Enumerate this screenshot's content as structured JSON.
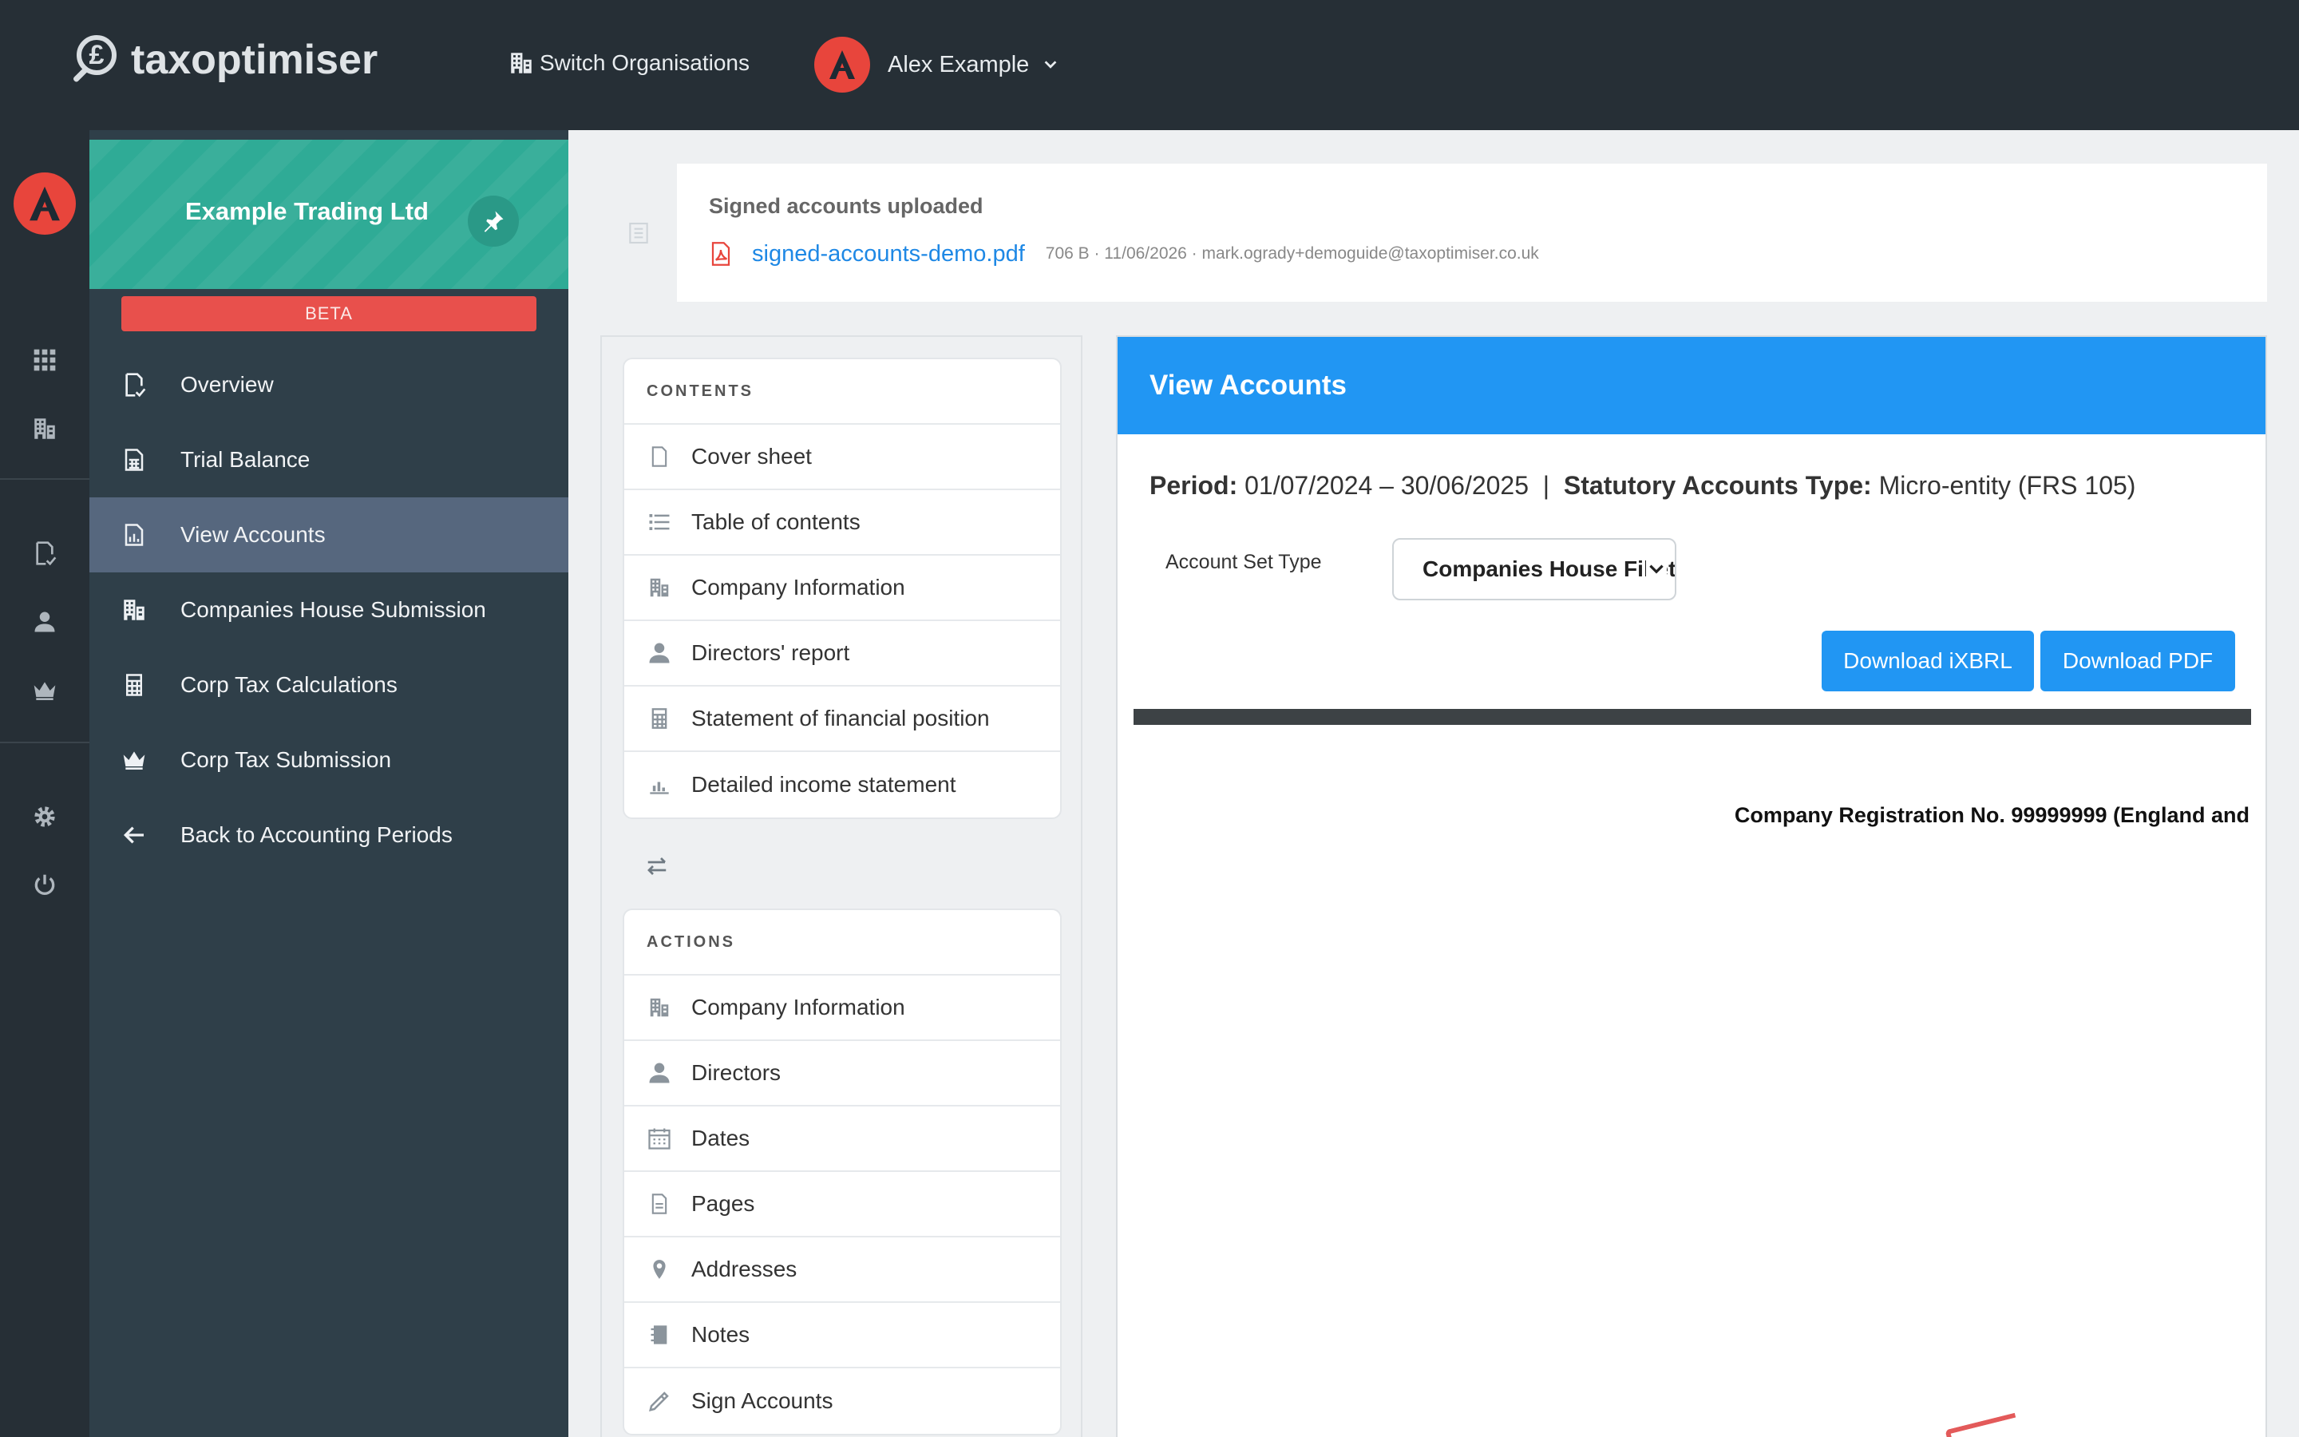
{
  "topbar": {
    "brand": "taxoptimiser",
    "switch_org": "Switch Organisations",
    "user_name": "Alex Example"
  },
  "rail": {
    "icons": [
      "avatar-icon",
      "apps-grid-icon",
      "organisation-icon",
      "document-check-icon",
      "person-icon",
      "crown-icon",
      "gear-icon",
      "power-icon"
    ]
  },
  "sidebar": {
    "org_name": "Example Trading Ltd",
    "beta_label": "BETA",
    "items": [
      {
        "label": "Overview",
        "icon": "document-check-icon"
      },
      {
        "label": "Trial Balance",
        "icon": "spreadsheet-icon"
      },
      {
        "label": "View Accounts",
        "icon": "report-chart-icon",
        "active": true
      },
      {
        "label": "Companies House Submission",
        "icon": "organisation-icon"
      },
      {
        "label": "Corp Tax Calculations",
        "icon": "calculator-icon"
      },
      {
        "label": "Corp Tax Submission",
        "icon": "crown-icon"
      },
      {
        "label": "Back to Accounting Periods",
        "icon": "arrow-left-icon"
      }
    ]
  },
  "upload": {
    "title": "Signed accounts uploaded",
    "file_name": "signed-accounts-demo.pdf",
    "meta": "706 B · 11/06/2026 · mark.ogrady+demoguide@taxoptimiser.co.uk"
  },
  "contents": {
    "heading": "CONTENTS",
    "items": [
      {
        "label": "Cover sheet",
        "icon": "page-icon"
      },
      {
        "label": "Table of contents",
        "icon": "list-icon"
      },
      {
        "label": "Company Information",
        "icon": "organisation-icon"
      },
      {
        "label": "Directors' report",
        "icon": "person-icon"
      },
      {
        "label": "Statement of financial position",
        "icon": "calculator-icon"
      },
      {
        "label": "Detailed income statement",
        "icon": "bar-chart-icon"
      }
    ]
  },
  "actions": {
    "heading": "ACTIONS",
    "items": [
      {
        "label": "Company Information",
        "icon": "organisation-icon"
      },
      {
        "label": "Directors",
        "icon": "person-icon"
      },
      {
        "label": "Dates",
        "icon": "calendar-icon"
      },
      {
        "label": "Pages",
        "icon": "page-icon"
      },
      {
        "label": "Addresses",
        "icon": "map-pin-icon"
      },
      {
        "label": "Notes",
        "icon": "notebook-icon"
      },
      {
        "label": "Sign Accounts",
        "icon": "pen-icon"
      }
    ]
  },
  "view": {
    "title": "View Accounts",
    "period_label": "Period:",
    "period_value": "01/07/2024 – 30/06/2025",
    "separator": "|",
    "type_label": "Statutory Accounts Type:",
    "type_value": "Micro-entity (FRS 105)",
    "account_set_label": "Account Set Type",
    "account_set_value": "Companies House Filleted",
    "download_ixbrl": "Download iXBRL",
    "download_pdf": "Download PDF",
    "doc_reg_line": "Company Registration No. 99999999 (England and"
  },
  "colors": {
    "topbar": "#262f36",
    "sidebar": "#2f3f49",
    "org_header": "#2fab96",
    "active_item": "#56677e",
    "beta": "#e8504c",
    "primary": "#2196f3",
    "brand_red": "#e8453c"
  }
}
